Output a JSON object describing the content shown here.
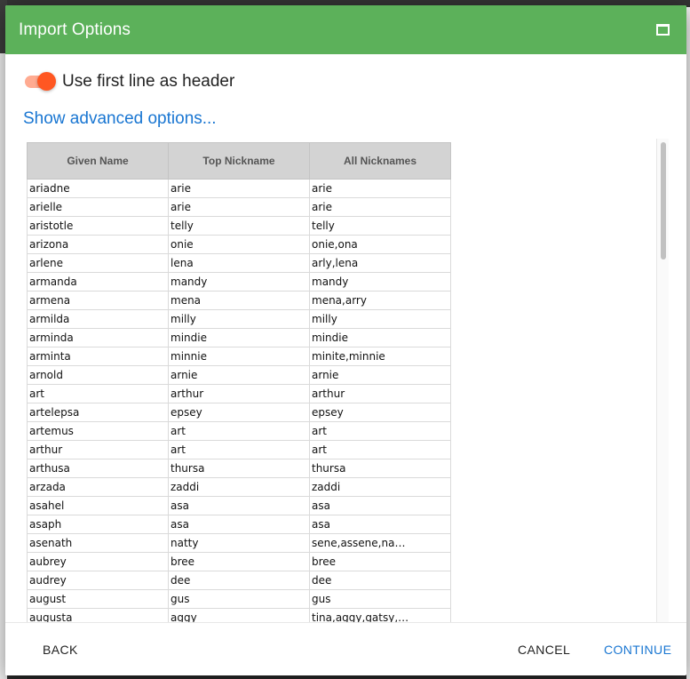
{
  "dialog": {
    "title": "Import Options",
    "header_toggle_label": "Use first line as header",
    "header_toggle_on": true,
    "advanced_link": "Show advanced options...",
    "accent_color": "#5cb15a",
    "toggle_color": "#ff5722",
    "link_color": "#1976d2"
  },
  "table": {
    "columns": [
      "Given Name",
      "Top Nickname",
      "All Nicknames"
    ],
    "rows": [
      [
        "ariadne",
        "arie",
        "arie"
      ],
      [
        "arielle",
        "arie",
        "arie"
      ],
      [
        "aristotle",
        "telly",
        "telly"
      ],
      [
        "arizona",
        "onie",
        "onie,ona"
      ],
      [
        "arlene",
        "lena",
        "arly,lena"
      ],
      [
        "armanda",
        "mandy",
        "mandy"
      ],
      [
        "armena",
        "mena",
        "mena,arry"
      ],
      [
        "armilda",
        "milly",
        "milly"
      ],
      [
        "arminda",
        "mindie",
        "mindie"
      ],
      [
        "arminta",
        "minnie",
        "minite,minnie"
      ],
      [
        "arnold",
        "arnie",
        "arnie"
      ],
      [
        "art",
        "arthur",
        "arthur"
      ],
      [
        "artelepsa",
        "epsey",
        "epsey"
      ],
      [
        "artemus",
        "art",
        "art"
      ],
      [
        "arthur",
        "art",
        "art"
      ],
      [
        "arthusa",
        "thursa",
        "thursa"
      ],
      [
        "arzada",
        "zaddi",
        "zaddi"
      ],
      [
        "asahel",
        "asa",
        "asa"
      ],
      [
        "asaph",
        "asa",
        "asa"
      ],
      [
        "asenath",
        "natty",
        "sene,assene,na…"
      ],
      [
        "aubrey",
        "bree",
        "bree"
      ],
      [
        "audrey",
        "dee",
        "dee"
      ],
      [
        "august",
        "gus",
        "gus"
      ],
      [
        "augusta",
        "aggy",
        "tina,aggy,gatsy,…"
      ]
    ]
  },
  "footer": {
    "back_label": "BACK",
    "cancel_label": "CANCEL",
    "continue_label": "CONTINUE"
  }
}
